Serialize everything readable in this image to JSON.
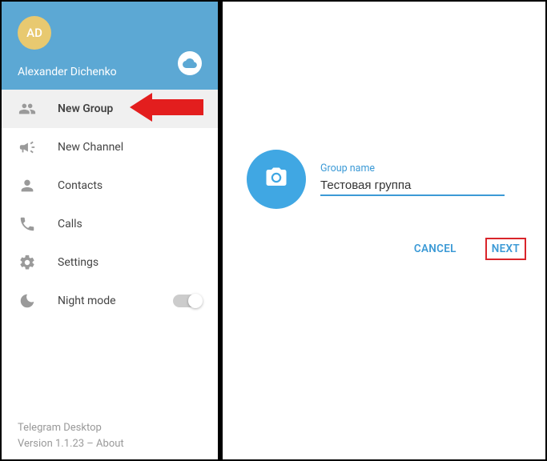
{
  "profile": {
    "initials": "AD",
    "username": "Alexander Dichenko"
  },
  "menu": {
    "new_group": "New Group",
    "new_channel": "New Channel",
    "contacts": "Contacts",
    "calls": "Calls",
    "settings": "Settings",
    "night_mode": "Night mode"
  },
  "footer": {
    "appname": "Telegram Desktop",
    "version_line": "Version 1.1.23 – About"
  },
  "dialog": {
    "group_name_label": "Group name",
    "group_name_value": "Тестовая группа",
    "cancel": "CANCEL",
    "next": "NEXT"
  },
  "colors": {
    "accent": "#3c9ad6",
    "header": "#5ca8d4",
    "highlight_border": "#d9252b",
    "arrow": "#e31e1e"
  }
}
